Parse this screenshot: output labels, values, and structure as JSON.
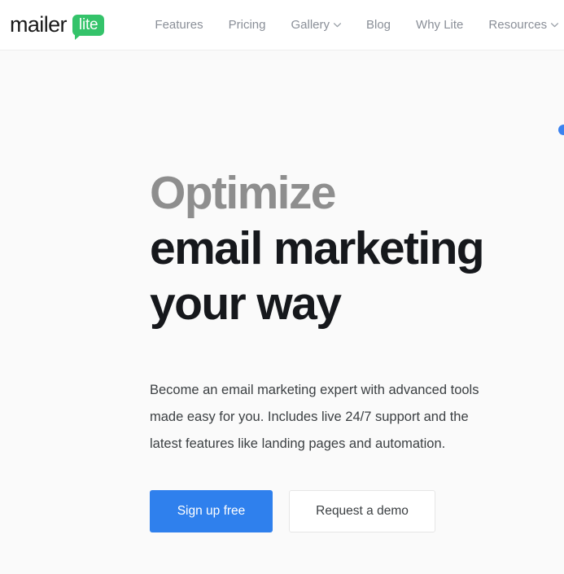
{
  "header": {
    "logo": {
      "word": "mailer",
      "badge": "lite",
      "badge_color": "#34c36a"
    },
    "nav": [
      {
        "label": "Features",
        "has_chevron": false,
        "icon": ""
      },
      {
        "label": "Pricing",
        "has_chevron": false,
        "icon": ""
      },
      {
        "label": "Gallery",
        "has_chevron": true,
        "icon": "chevron-down-icon"
      },
      {
        "label": "Blog",
        "has_chevron": false,
        "icon": ""
      },
      {
        "label": "Why Lite",
        "has_chevron": false,
        "icon": ""
      },
      {
        "label": "Resources",
        "has_chevron": true,
        "icon": "chevron-down-icon"
      }
    ]
  },
  "hero": {
    "headline_line1": "Optimize",
    "headline_line2": "email marketing",
    "headline_line3": "your way",
    "headline_muted_color": "#8e8e8e",
    "headline_color": "#16181c",
    "paragraph": "Become an email marketing expert with advanced tools made easy for you. Includes live 24/7 support and the latest features like landing pages and automation.",
    "primary_button": "Sign up free",
    "secondary_button": "Request a demo",
    "primary_button_color": "#2f80ed",
    "decoration_dot_color": "#3b82f0"
  }
}
